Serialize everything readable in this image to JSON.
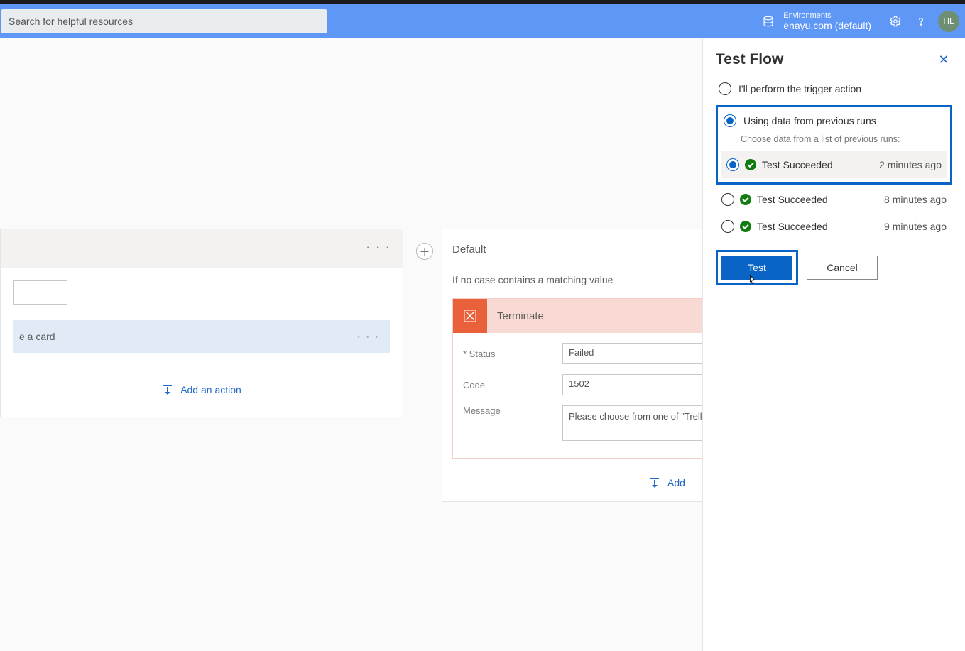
{
  "header": {
    "search_placeholder": "Search for helpful resources",
    "env_label": "Environments",
    "env_name": "enayu.com (default)",
    "avatar_initials": "HL"
  },
  "case_card": {
    "row_text": "e a card",
    "add_action": "Add an action"
  },
  "default_card": {
    "title": "Default",
    "subtitle": "If no case contains a matching value",
    "terminate_title": "Terminate",
    "fields": {
      "status_label": "* Status",
      "status_value": "Failed",
      "code_label": "Code",
      "code_value": "1502",
      "message_label": "Message",
      "message_value": "Please choose from one of \"Trello\", Tweet\""
    },
    "add_action_partial": "Add"
  },
  "panel": {
    "title": "Test Flow",
    "option_manual": "I'll perform the trigger action",
    "option_previous": "Using data from previous runs",
    "previous_sub": "Choose data from a list of previous runs:",
    "runs": [
      {
        "status": "Test Succeeded",
        "time": "2 minutes ago",
        "selected": true
      },
      {
        "status": "Test Succeeded",
        "time": "8 minutes ago",
        "selected": false
      },
      {
        "status": "Test Succeeded",
        "time": "9 minutes ago",
        "selected": false
      }
    ],
    "test_button": "Test",
    "cancel_button": "Cancel"
  }
}
